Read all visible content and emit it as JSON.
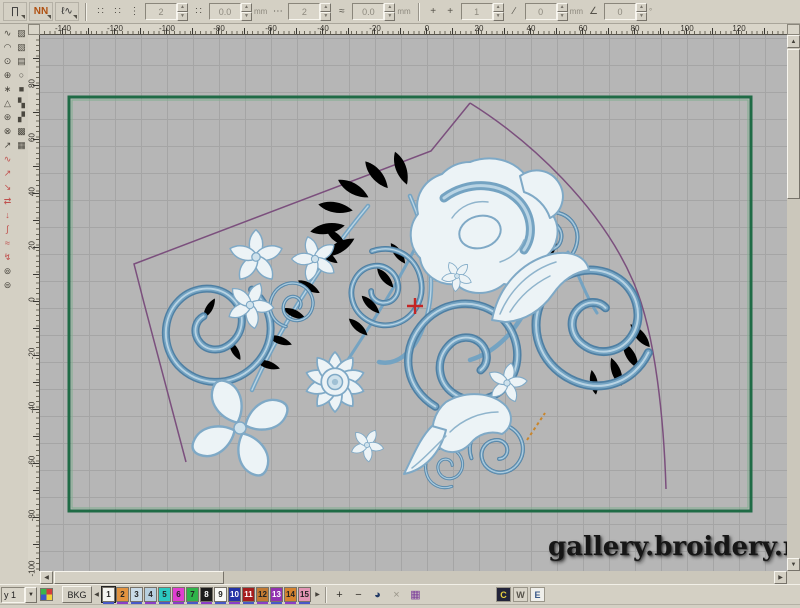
{
  "colors": {
    "beige": "#d4d0c4",
    "canvas-bg": "#b6b6b6",
    "grid-line": "#a5a5a5",
    "green": "#1f6b45",
    "purple": "#7b4f7d",
    "blue": "#74a3c2",
    "blue-dk": "#4e7fa3",
    "blue-lt": "#b9d4e4",
    "pale": "#ecf3f6",
    "red": "#c42525",
    "orange": "#c8852c"
  },
  "icons": {
    "prev": "◀",
    "next": "▶",
    "plus": "+",
    "minus": "−",
    "up": "▲",
    "down": "▼",
    "left": "◀",
    "right": "▶",
    "dropdown": "▼"
  },
  "top_toolbar": {
    "items": [
      {
        "t": "btn",
        "name": "stitch-marks-tool",
        "g": "∏"
      },
      {
        "t": "btn",
        "name": "stitch-pattern-tool",
        "g": "NN",
        "accent": true
      },
      {
        "t": "btn",
        "name": "curve-edit-tool",
        "g": "ℓ∿"
      },
      {
        "t": "sep"
      },
      {
        "t": "icon",
        "name": "points-grid-icon",
        "g": "∷"
      },
      {
        "t": "icon",
        "name": "points-grid2-icon",
        "g": "∷"
      },
      {
        "t": "icon",
        "name": "list-icon",
        "g": "⋮"
      },
      {
        "t": "field",
        "name": "stitch-count-field",
        "v": "2",
        "u": ""
      },
      {
        "t": "icon",
        "name": "density-icon",
        "g": "∷"
      },
      {
        "t": "field",
        "name": "stitch-length-field",
        "v": "0.0",
        "u": "mm"
      },
      {
        "t": "icon",
        "name": "dots-icon",
        "g": "⋯"
      },
      {
        "t": "field",
        "name": "repeat-count-field",
        "v": "2",
        "u": ""
      },
      {
        "t": "icon",
        "name": "ratio-icon",
        "g": "≈"
      },
      {
        "t": "field",
        "name": "stitch-width-field",
        "v": "0.0",
        "u": "mm"
      },
      {
        "t": "sep"
      },
      {
        "t": "icon",
        "name": "anchor-icon",
        "g": "+"
      },
      {
        "t": "icon",
        "name": "anchor2-icon",
        "g": "+"
      },
      {
        "t": "field",
        "name": "scale-field",
        "v": "1",
        "u": ""
      },
      {
        "t": "icon",
        "name": "slash-icon",
        "g": "∕"
      },
      {
        "t": "field",
        "name": "offset-field",
        "v": "0",
        "u": "mm"
      },
      {
        "t": "icon",
        "name": "angle-icon",
        "g": "∠"
      },
      {
        "t": "field",
        "name": "angle-field",
        "v": "0",
        "u": "°"
      }
    ]
  },
  "left_toolbar": {
    "pair_icons": [
      "∿",
      "▨",
      "◠",
      "▧",
      "⊙",
      "▤",
      "⊕",
      "○",
      "∗",
      "■",
      "△",
      "▚",
      "⊛",
      "▞",
      "⊗",
      "▩",
      "↗",
      "▦"
    ],
    "red_icons": [
      "∿",
      "↗",
      "↘",
      "⇄",
      "↓",
      "∫",
      "≈",
      "↯"
    ],
    "round_icons": [
      "⊚",
      "⊜"
    ]
  },
  "rulers": {
    "top_labels": [
      "-140",
      "-120",
      "-100",
      "-80",
      "-60",
      "-40",
      "-20",
      "0",
      "20",
      "40",
      "60",
      "80",
      "100",
      "120"
    ],
    "left_labels": [
      "80",
      "60",
      "40",
      "20",
      "0",
      "-20",
      "-40",
      "-60",
      "-80",
      "-100"
    ]
  },
  "canvas": {
    "watermark": "gallery.broidery.ru"
  },
  "bottom_toolbar": {
    "layer_value": "y 1",
    "bkg_label": "BKG",
    "swatches": [
      {
        "n": "1",
        "c": "#f4f4f0",
        "t": "#222",
        "sel": true,
        "bar": "#4858c8"
      },
      {
        "n": "2",
        "c": "#e2933f",
        "t": "#222",
        "bar": "#8a3ec8"
      },
      {
        "n": "3",
        "c": "#cadbe8",
        "t": "#222",
        "bar": "#4858c8"
      },
      {
        "n": "4",
        "c": "#b7cfdf",
        "t": "#222",
        "bar": "#8a3ec8"
      },
      {
        "n": "5",
        "c": "#2cc8c0",
        "t": "#222",
        "bar": "#4858c8"
      },
      {
        "n": "6",
        "c": "#e03ed0",
        "t": "#222",
        "bar": "#8a3ec8"
      },
      {
        "n": "7",
        "c": "#2fb44a",
        "t": "#222",
        "bar": "#4858c8"
      },
      {
        "n": "8",
        "c": "#1c1c1c",
        "t": "#fff",
        "bar": "#8a3ec8"
      },
      {
        "n": "9",
        "c": "#f8f8f6",
        "t": "#222",
        "bar": "#4858c8"
      },
      {
        "n": "10",
        "c": "#2433a6",
        "t": "#fff",
        "bar": "#8a3ec8"
      },
      {
        "n": "11",
        "c": "#a51d1d",
        "t": "#fff",
        "bar": "#4858c8"
      },
      {
        "n": "12",
        "c": "#c27a33",
        "t": "#222",
        "bar": "#8a3ec8"
      },
      {
        "n": "13",
        "c": "#9232b0",
        "t": "#fff",
        "bar": "#4858c8"
      },
      {
        "n": "14",
        "c": "#d6832f",
        "t": "#222",
        "bar": "#8a3ec8"
      },
      {
        "n": "15",
        "c": "#e395b5",
        "t": "#222",
        "bar": "#4858c8"
      }
    ],
    "tool_icons": [
      {
        "name": "spool-icon",
        "g": "◕",
        "c": "#223a66"
      },
      {
        "name": "cut-icon",
        "g": "×",
        "c": "#9a968a"
      },
      {
        "name": "palette-grid-icon",
        "g": "▦",
        "c": "#7a3a9a"
      }
    ],
    "app_icons": [
      {
        "name": "app-icon-1",
        "g": "C",
        "bg": "#23243a",
        "fg": "#e8d040"
      },
      {
        "name": "app-icon-2",
        "g": "W",
        "bg": "#d9d5c9",
        "fg": "#55524a"
      },
      {
        "name": "app-icon-3",
        "g": "E",
        "bg": "#efefeb",
        "fg": "#3a5a8a"
      }
    ]
  }
}
